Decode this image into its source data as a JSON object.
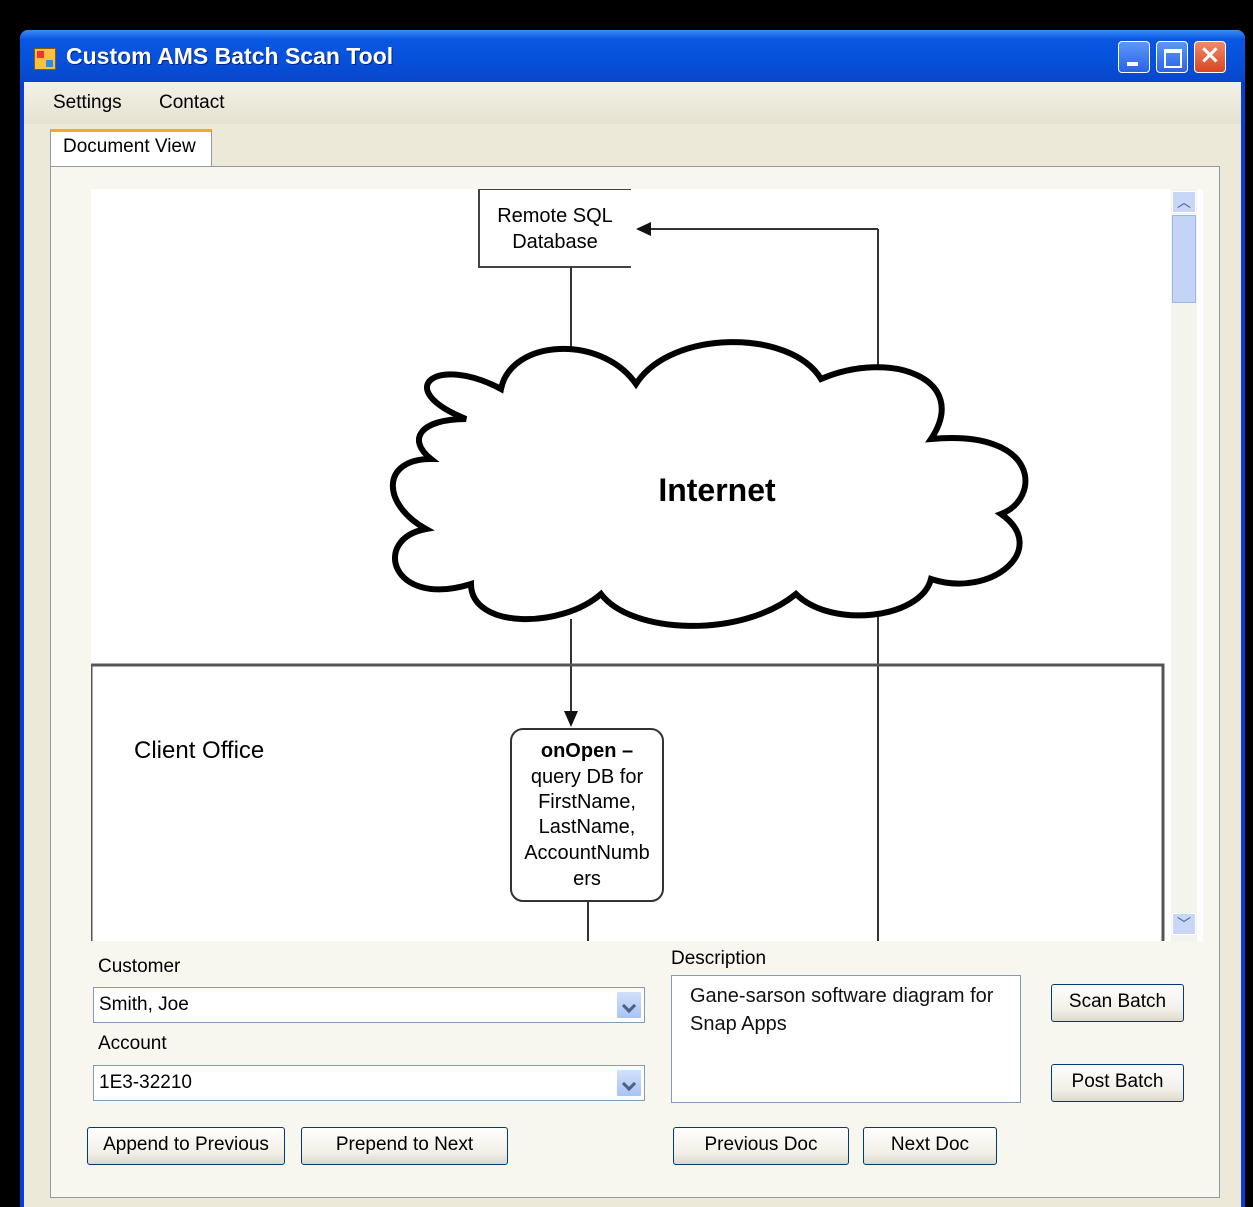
{
  "window": {
    "title": "Custom AMS Batch Scan Tool"
  },
  "menu": {
    "settings": "Settings",
    "contact": "Contact"
  },
  "tabs": [
    {
      "label": "Document View"
    }
  ],
  "diagram": {
    "remote_db": [
      "Remote SQL",
      "Database"
    ],
    "cloud_label": "Internet",
    "office_label": "Client Office",
    "process_title": "onOpen –",
    "process_lines": [
      "query DB for",
      "FirstName,",
      "LastName,",
      "AccountNumb",
      "ers"
    ]
  },
  "form": {
    "customer_label": "Customer",
    "customer_value": "Smith, Joe",
    "account_label": "Account",
    "account_value": "1E3-32210",
    "description_label": "Description",
    "description_value": "Gane-sarson software diagram for Snap Apps"
  },
  "buttons": {
    "scan_batch": "Scan Batch",
    "post_batch": "Post Batch",
    "append_previous": "Append to Previous",
    "prepend_next": "Prepend to Next",
    "previous_doc": "Previous Doc",
    "next_doc": "Next Doc"
  }
}
